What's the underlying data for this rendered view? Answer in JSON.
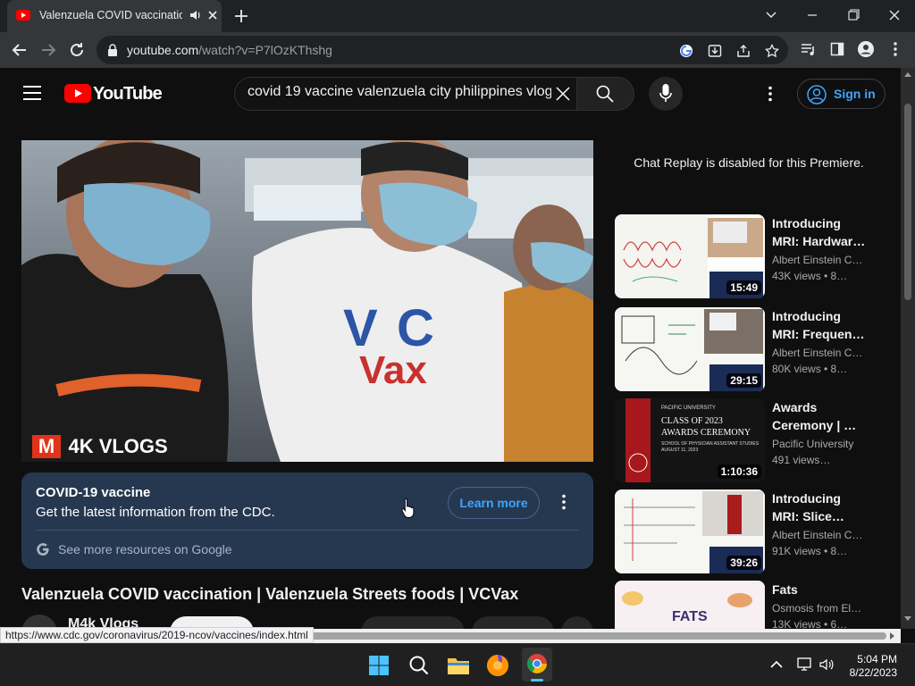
{
  "browser": {
    "tab_title": "Valenzuela COVID vaccinatio",
    "url_host": "youtube.com",
    "url_path": "/watch?v=P7lOzKThshg"
  },
  "masthead": {
    "brand": "YouTube",
    "search_value": "covid 19 vaccine valenzuela city philippines vlog",
    "signin_label": "Sign in"
  },
  "video": {
    "overlay_logo_letter": "M",
    "overlay_logo_text": "4K VLOGS",
    "shirt_text": "VC Vax"
  },
  "info_panel": {
    "title": "COVID-19 vaccine",
    "subtitle": "Get the latest information from the CDC.",
    "learn_more": "Learn more",
    "more_resources": "See more resources on Google"
  },
  "watch": {
    "title": "Valenzuela COVID vaccination | Valenzuela Streets foods | VCVax",
    "channel": "M4k Vlogs"
  },
  "sidebar": {
    "chat_replay": "Chat Replay is disabled for this Premiere.",
    "recommendations": [
      {
        "title": "Introducing MRI: Hardwar…",
        "channel": "Albert Einstein C…",
        "views": "43K views • 8…",
        "duration": "15:49"
      },
      {
        "title": "Introducing MRI: Frequen…",
        "channel": "Albert Einstein C…",
        "views": "80K views • 8…",
        "duration": "29:15"
      },
      {
        "title": "Awards Ceremony | …",
        "channel": "Pacific University",
        "views": "491 views…",
        "duration": "1:10:36",
        "thumb_lines": [
          "PACIFIC UNIVERSITY",
          "CLASS OF 2023",
          "AWARDS CEREMONY",
          "SCHOOL OF PHYSICIAN ASSISTANT STUDIES",
          "AUGUST 11, 2023"
        ]
      },
      {
        "title": "Introducing MRI: Slice…",
        "channel": "Albert Einstein C…",
        "views": "91K views • 8…",
        "duration": "39:26"
      },
      {
        "title": "Fats",
        "channel": "Osmosis from El…",
        "views": "13K views • 6…",
        "thumb_text": "FATS"
      }
    ]
  },
  "status_bar_url": "https://www.cdc.gov/coronavirus/2019-ncov/vaccines/index.html",
  "taskbar": {
    "time": "5:04 PM",
    "date": "8/22/2023"
  },
  "colors": {
    "yt_red": "#ff0000",
    "link_blue": "#3ea6ff",
    "info_panel_bg": "#263850"
  }
}
